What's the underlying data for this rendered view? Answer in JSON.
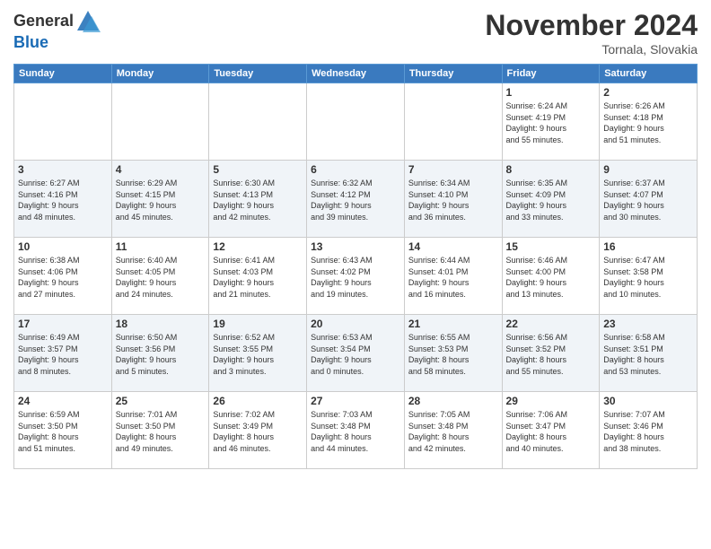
{
  "logo": {
    "general": "General",
    "blue": "Blue"
  },
  "header": {
    "month": "November 2024",
    "location": "Tornala, Slovakia"
  },
  "weekdays": [
    "Sunday",
    "Monday",
    "Tuesday",
    "Wednesday",
    "Thursday",
    "Friday",
    "Saturday"
  ],
  "weeks": [
    [
      {
        "day": "",
        "info": ""
      },
      {
        "day": "",
        "info": ""
      },
      {
        "day": "",
        "info": ""
      },
      {
        "day": "",
        "info": ""
      },
      {
        "day": "",
        "info": ""
      },
      {
        "day": "1",
        "info": "Sunrise: 6:24 AM\nSunset: 4:19 PM\nDaylight: 9 hours\nand 55 minutes."
      },
      {
        "day": "2",
        "info": "Sunrise: 6:26 AM\nSunset: 4:18 PM\nDaylight: 9 hours\nand 51 minutes."
      }
    ],
    [
      {
        "day": "3",
        "info": "Sunrise: 6:27 AM\nSunset: 4:16 PM\nDaylight: 9 hours\nand 48 minutes."
      },
      {
        "day": "4",
        "info": "Sunrise: 6:29 AM\nSunset: 4:15 PM\nDaylight: 9 hours\nand 45 minutes."
      },
      {
        "day": "5",
        "info": "Sunrise: 6:30 AM\nSunset: 4:13 PM\nDaylight: 9 hours\nand 42 minutes."
      },
      {
        "day": "6",
        "info": "Sunrise: 6:32 AM\nSunset: 4:12 PM\nDaylight: 9 hours\nand 39 minutes."
      },
      {
        "day": "7",
        "info": "Sunrise: 6:34 AM\nSunset: 4:10 PM\nDaylight: 9 hours\nand 36 minutes."
      },
      {
        "day": "8",
        "info": "Sunrise: 6:35 AM\nSunset: 4:09 PM\nDaylight: 9 hours\nand 33 minutes."
      },
      {
        "day": "9",
        "info": "Sunrise: 6:37 AM\nSunset: 4:07 PM\nDaylight: 9 hours\nand 30 minutes."
      }
    ],
    [
      {
        "day": "10",
        "info": "Sunrise: 6:38 AM\nSunset: 4:06 PM\nDaylight: 9 hours\nand 27 minutes."
      },
      {
        "day": "11",
        "info": "Sunrise: 6:40 AM\nSunset: 4:05 PM\nDaylight: 9 hours\nand 24 minutes."
      },
      {
        "day": "12",
        "info": "Sunrise: 6:41 AM\nSunset: 4:03 PM\nDaylight: 9 hours\nand 21 minutes."
      },
      {
        "day": "13",
        "info": "Sunrise: 6:43 AM\nSunset: 4:02 PM\nDaylight: 9 hours\nand 19 minutes."
      },
      {
        "day": "14",
        "info": "Sunrise: 6:44 AM\nSunset: 4:01 PM\nDaylight: 9 hours\nand 16 minutes."
      },
      {
        "day": "15",
        "info": "Sunrise: 6:46 AM\nSunset: 4:00 PM\nDaylight: 9 hours\nand 13 minutes."
      },
      {
        "day": "16",
        "info": "Sunrise: 6:47 AM\nSunset: 3:58 PM\nDaylight: 9 hours\nand 10 minutes."
      }
    ],
    [
      {
        "day": "17",
        "info": "Sunrise: 6:49 AM\nSunset: 3:57 PM\nDaylight: 9 hours\nand 8 minutes."
      },
      {
        "day": "18",
        "info": "Sunrise: 6:50 AM\nSunset: 3:56 PM\nDaylight: 9 hours\nand 5 minutes."
      },
      {
        "day": "19",
        "info": "Sunrise: 6:52 AM\nSunset: 3:55 PM\nDaylight: 9 hours\nand 3 minutes."
      },
      {
        "day": "20",
        "info": "Sunrise: 6:53 AM\nSunset: 3:54 PM\nDaylight: 9 hours\nand 0 minutes."
      },
      {
        "day": "21",
        "info": "Sunrise: 6:55 AM\nSunset: 3:53 PM\nDaylight: 8 hours\nand 58 minutes."
      },
      {
        "day": "22",
        "info": "Sunrise: 6:56 AM\nSunset: 3:52 PM\nDaylight: 8 hours\nand 55 minutes."
      },
      {
        "day": "23",
        "info": "Sunrise: 6:58 AM\nSunset: 3:51 PM\nDaylight: 8 hours\nand 53 minutes."
      }
    ],
    [
      {
        "day": "24",
        "info": "Sunrise: 6:59 AM\nSunset: 3:50 PM\nDaylight: 8 hours\nand 51 minutes."
      },
      {
        "day": "25",
        "info": "Sunrise: 7:01 AM\nSunset: 3:50 PM\nDaylight: 8 hours\nand 49 minutes."
      },
      {
        "day": "26",
        "info": "Sunrise: 7:02 AM\nSunset: 3:49 PM\nDaylight: 8 hours\nand 46 minutes."
      },
      {
        "day": "27",
        "info": "Sunrise: 7:03 AM\nSunset: 3:48 PM\nDaylight: 8 hours\nand 44 minutes."
      },
      {
        "day": "28",
        "info": "Sunrise: 7:05 AM\nSunset: 3:48 PM\nDaylight: 8 hours\nand 42 minutes."
      },
      {
        "day": "29",
        "info": "Sunrise: 7:06 AM\nSunset: 3:47 PM\nDaylight: 8 hours\nand 40 minutes."
      },
      {
        "day": "30",
        "info": "Sunrise: 7:07 AM\nSunset: 3:46 PM\nDaylight: 8 hours\nand 38 minutes."
      }
    ]
  ]
}
